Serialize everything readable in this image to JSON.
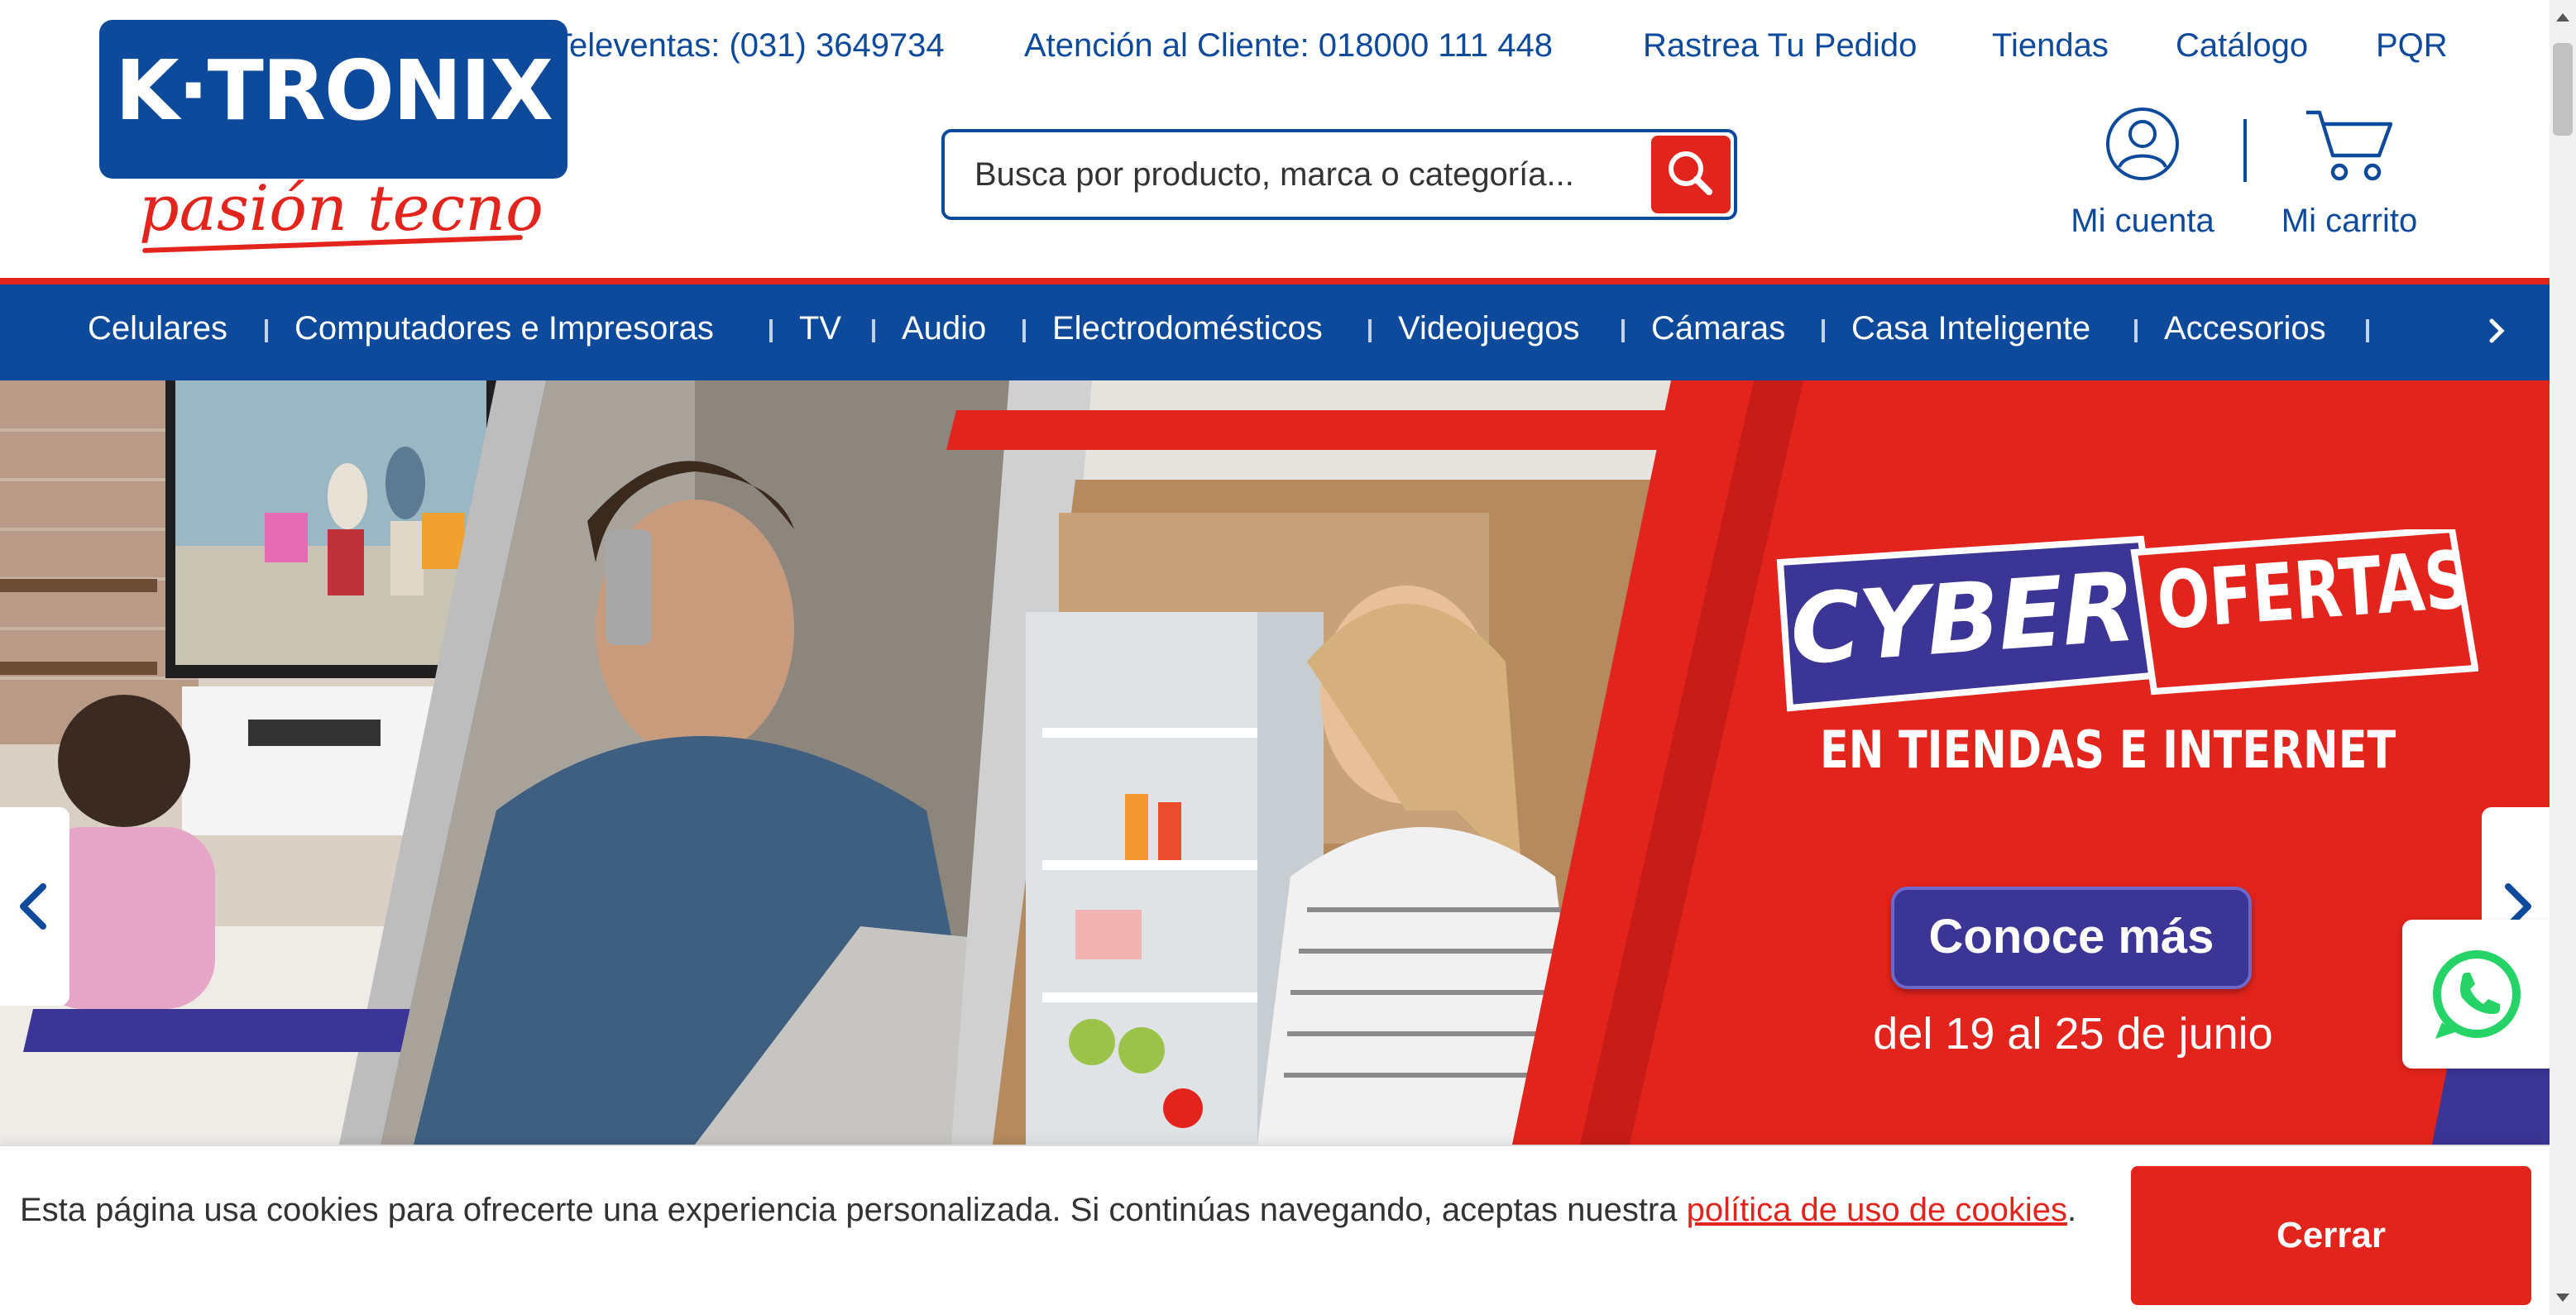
{
  "brand": {
    "logo_text": "K·TRONIX",
    "tagline": "pasión tecno",
    "primary_color": "#0d4a9c",
    "accent_color": "#e3241c"
  },
  "top_links": [
    {
      "label": "Televentas: (031) 3649734"
    },
    {
      "label": "Atención al Cliente: 018000 111 448"
    },
    {
      "label": "Rastrea Tu Pedido"
    },
    {
      "label": "Tiendas"
    },
    {
      "label": "Catálogo"
    },
    {
      "label": "PQR"
    }
  ],
  "search": {
    "placeholder": "Busca por producto, marca o categoría...",
    "icon": "search-icon"
  },
  "account": {
    "label": "Mi cuenta",
    "icon": "user-icon"
  },
  "cart": {
    "label": "Mi carrito",
    "icon": "cart-icon"
  },
  "nav": {
    "items": [
      {
        "label": "Celulares"
      },
      {
        "label": "Computadores e Impresoras"
      },
      {
        "label": "TV"
      },
      {
        "label": "Audio"
      },
      {
        "label": "Electrodomésticos"
      },
      {
        "label": "Videojuegos"
      },
      {
        "label": "Cámaras"
      },
      {
        "label": "Casa Inteligente"
      },
      {
        "label": "Accesorios"
      }
    ],
    "next_icon": "chevron-right-icon"
  },
  "hero": {
    "title_word_1": "CYBER",
    "title_word_2": "OFERTAS",
    "subtitle": "EN TIENDAS E INTERNET",
    "cta_label": "Conoce más",
    "dates": "del 19 al 25 de junio"
  },
  "cookie": {
    "text": "Esta página usa cookies para ofrecerte una experiencia personalizada. Si continúas navegando, aceptas nuestra ",
    "link_text": "política de uso de cookies",
    "suffix": ".",
    "button_label": "Cerrar"
  }
}
